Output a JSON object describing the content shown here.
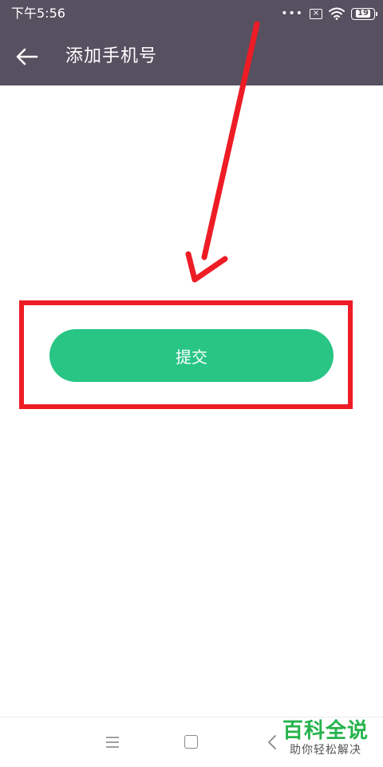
{
  "status_bar": {
    "time": "下午5:56",
    "dots": "•••",
    "sim_icon": "sim-card-x-icon",
    "wifi_icon": "wifi-icon",
    "battery_level": "19"
  },
  "app_bar": {
    "back_icon": "arrow-left-icon",
    "title": "添加手机号"
  },
  "main": {
    "submit_label": "提交"
  },
  "annotation": {
    "arrow_icon": "red-arrow-icon",
    "highlight_color": "#ee1c25"
  },
  "nav_bar": {
    "menu_icon": "menu-icon",
    "home_icon": "home-square-icon",
    "back_icon": "chevron-left-icon"
  },
  "watermark": {
    "title": "百科全说",
    "subtitle": "助你轻松解决"
  },
  "colors": {
    "header_bg": "#575060",
    "button_bg": "#28c585",
    "annotation_red": "#ee1c25",
    "watermark_green": "#26b34c"
  }
}
